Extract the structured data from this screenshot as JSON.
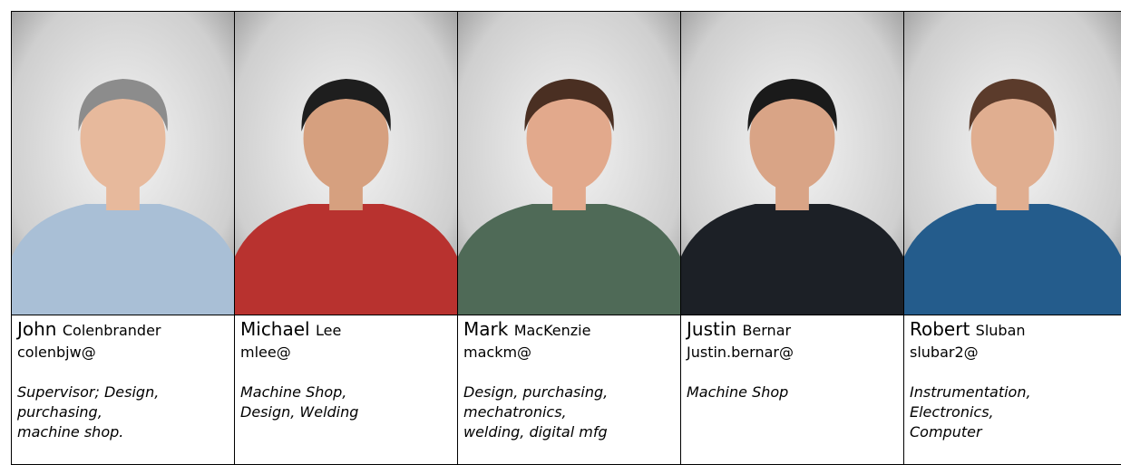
{
  "people": [
    {
      "first_name": "John",
      "last_name": "Colenbrander",
      "email": "colenbjw@",
      "roles": [
        "Supervisor; Design,",
        "purchasing,",
        "machine shop."
      ],
      "colors": {
        "shirt": "#a9bfd6",
        "hair": "#8c8c8c",
        "skin": "#e7b99c"
      }
    },
    {
      "first_name": "Michael",
      "last_name": "Lee",
      "email": "mlee@",
      "roles": [
        "Machine Shop,",
        "Design, Welding"
      ],
      "colors": {
        "shirt": "#b8322f",
        "hair": "#1e1e1e",
        "skin": "#d6a07f"
      }
    },
    {
      "first_name": "Mark",
      "last_name": "MacKenzie",
      "email": "mackm@",
      "roles": [
        "Design, purchasing,",
        "mechatronics,",
        "welding, digital mfg"
      ],
      "colors": {
        "shirt": "#4f6a57",
        "hair": "#4a2f22",
        "skin": "#e2a98c"
      }
    },
    {
      "first_name": "Justin",
      "last_name": "Bernar",
      "email": "Justin.bernar@",
      "roles": [
        "Machine Shop"
      ],
      "colors": {
        "shirt": "#1c2026",
        "hair": "#1a1a1a",
        "skin": "#d9a486"
      }
    },
    {
      "first_name": "Robert",
      "last_name": "Sluban",
      "email": "slubar2@",
      "roles": [
        "Instrumentation,",
        "Electronics,",
        "Computer"
      ],
      "colors": {
        "shirt": "#245c8c",
        "hair": "#5b3b2b",
        "skin": "#e0ae90"
      }
    }
  ]
}
